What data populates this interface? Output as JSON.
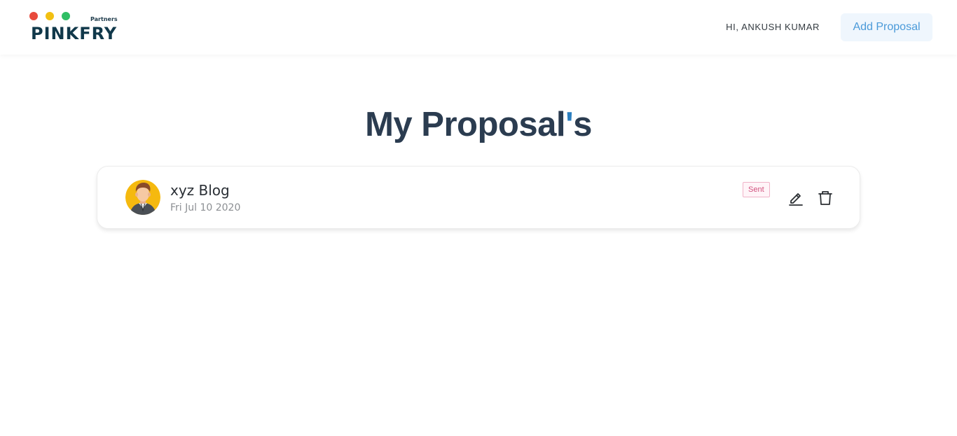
{
  "header": {
    "logo": {
      "wordmark": "PINKFRY",
      "tagline": "Partners",
      "dot_colors": [
        "#e84a3c",
        "#f2c012",
        "#2fbe64"
      ]
    },
    "greeting": "HI, ANKUSH KUMAR",
    "add_button_label": "Add Proposal"
  },
  "main": {
    "title_main": "My Proposal",
    "title_apostrophe": "'",
    "title_suffix": "s",
    "proposals": [
      {
        "title": "xyz Blog",
        "date": "Fri Jul 10 2020",
        "status": "Sent",
        "avatar_icon": "person-avatar-icon",
        "actions": [
          "edit-icon",
          "trash-icon"
        ]
      }
    ]
  },
  "colors": {
    "title": "#2b3c50",
    "accent": "#2b7fc0",
    "button_bg": "#eff6fd",
    "button_text": "#4a9ad9",
    "status_text": "#d1527e",
    "status_border": "#f0b3c8"
  }
}
